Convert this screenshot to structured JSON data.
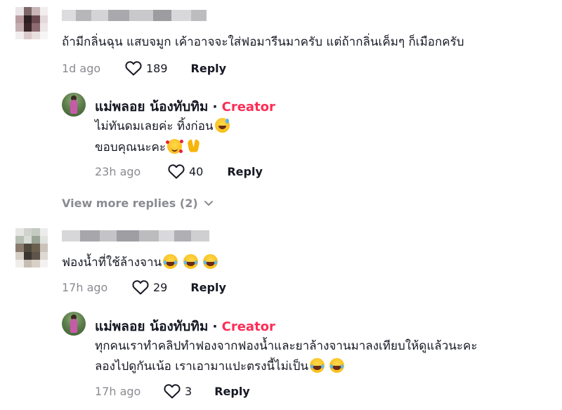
{
  "comments": [
    {
      "text": "ถ้ามีกลิ่นฉุน แสบจมูก เค้าอาจจะใส่ฟอมารีนมาครับ แต่ถ้ากลิ่นเค็มๆ ก็เมือกครับ",
      "time": "1d ago",
      "likes": "189",
      "reply_label": "Reply"
    },
    {
      "text": "ฟองน้ำที่ใช้ล้างจาน",
      "time": "17h ago",
      "likes": "29",
      "reply_label": "Reply"
    }
  ],
  "replies": [
    {
      "author": "แม่พลอย น้องทับทิม",
      "separator": "·",
      "badge": "Creator",
      "line1": "ไม่ทันดมเลยค่ะ ทิ้งก่อน",
      "line2": "ขอบคุณนะคะ",
      "time": "23h ago",
      "likes": "40",
      "reply_label": "Reply"
    },
    {
      "author": "แม่พลอย น้องทับทิม",
      "separator": "·",
      "badge": "Creator",
      "line1": "ทุกคนเราทำคลิปทำฟองจากฟองน้ำและยาล้างจานมาลงเทียบให้ดูแล้วนะคะ",
      "line2": "ลองไปดูกันเน้อ เราเอามาแปะตรงนี้ไม่เป็น",
      "time": "17h ago",
      "likes": "3",
      "reply_label": "Reply"
    }
  ],
  "view_more": "View more replies (2)",
  "colors": {
    "accent": "#fe2c55",
    "muted": "#8a8b91",
    "text": "#161823"
  },
  "icons": {
    "like": "heart-outline-icon",
    "expand": "chevron-down-icon"
  }
}
